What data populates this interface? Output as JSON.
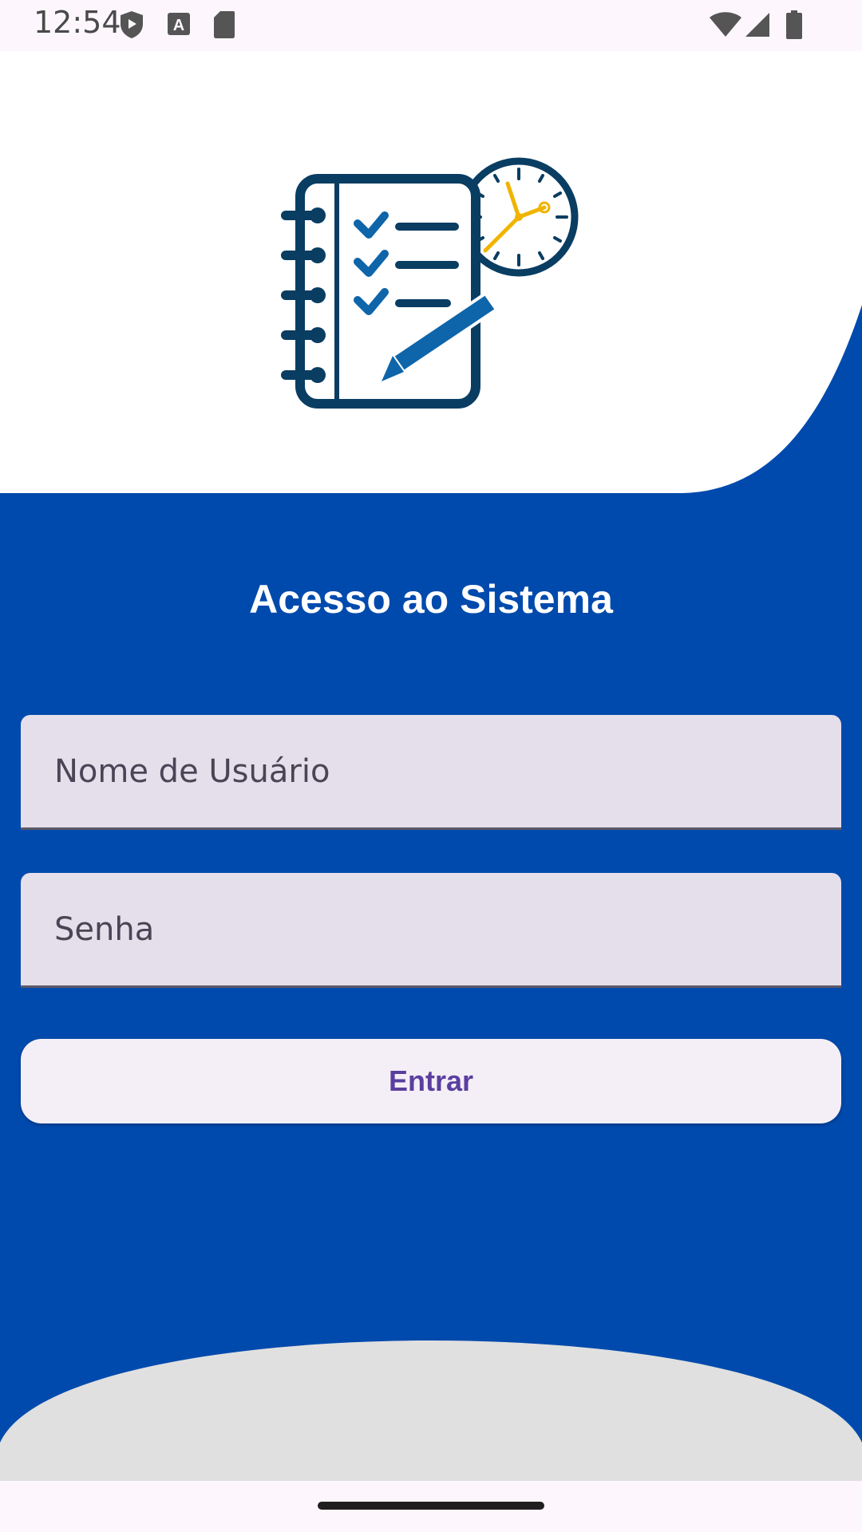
{
  "status_bar": {
    "time": "12:54",
    "left_icons": [
      "shield-play-icon",
      "keyboard-a-icon",
      "sd-card-icon"
    ],
    "right_icons": [
      "wifi-icon",
      "cell-signal-icon",
      "battery-icon"
    ]
  },
  "login": {
    "title": "Acesso ao Sistema",
    "username_placeholder": "Nome de Usuário",
    "password_placeholder": "Senha",
    "submit_label": "Entrar"
  },
  "colors": {
    "primary_blue": "#004aad",
    "logo_dark": "#0a3d62",
    "logo_blue": "#0e65a9",
    "clock_hand": "#f0b400",
    "field_bg": "#e5dfeb",
    "button_bg": "#f4eff7",
    "button_text": "#5b3f9e"
  }
}
